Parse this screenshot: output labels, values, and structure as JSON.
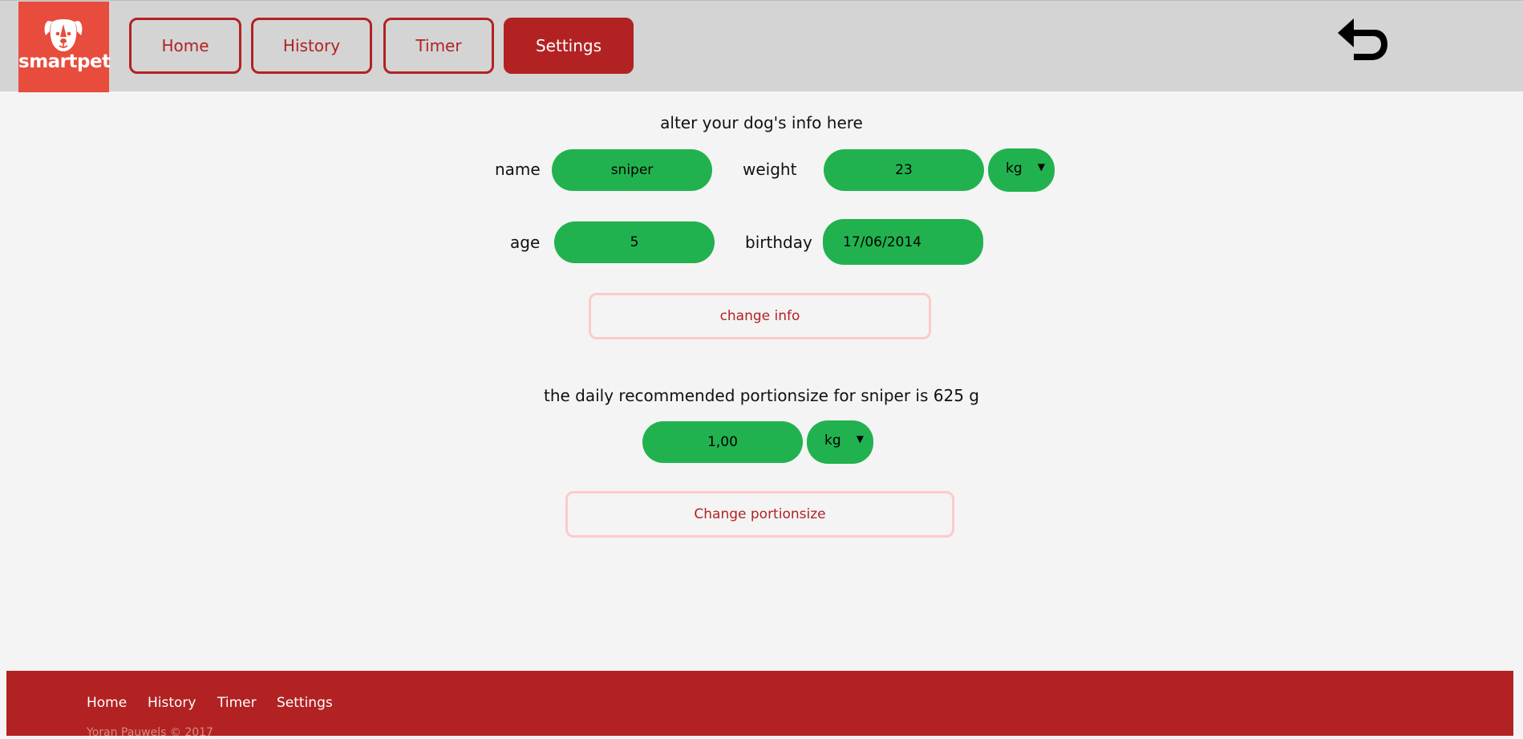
{
  "brand": {
    "name": "smartpet",
    "color": "#e74c3c",
    "icon": "dog-face-icon"
  },
  "nav": {
    "home": "Home",
    "history": "History",
    "timer": "Timer",
    "settings": "Settings",
    "active": "settings"
  },
  "toolbar": {
    "back_icon": "undo-arrow-icon"
  },
  "dog_info": {
    "heading": "alter your dog's info here",
    "name_label": "name",
    "name_value": "sniper",
    "weight_label": "weight",
    "weight_value": "23",
    "weight_unit": "kg",
    "age_label": "age",
    "age_value": "5",
    "birthday_label": "birthday",
    "birthday_value": "17/06/2014",
    "change_button": "change info"
  },
  "portion": {
    "heading": "the daily recommended portionsize for sniper is 625 g",
    "value": "1,00",
    "unit": "kg",
    "change_button": "Change portionsize"
  },
  "footer": {
    "links": [
      "Home",
      "History",
      "Timer",
      "Settings"
    ],
    "copyright": "Yoran Pauwels © 2017"
  },
  "colors": {
    "accent": "#b22222",
    "field": "#21b24f",
    "header_bg": "#d4d4d4",
    "page_bg": "#f4f4f4"
  }
}
